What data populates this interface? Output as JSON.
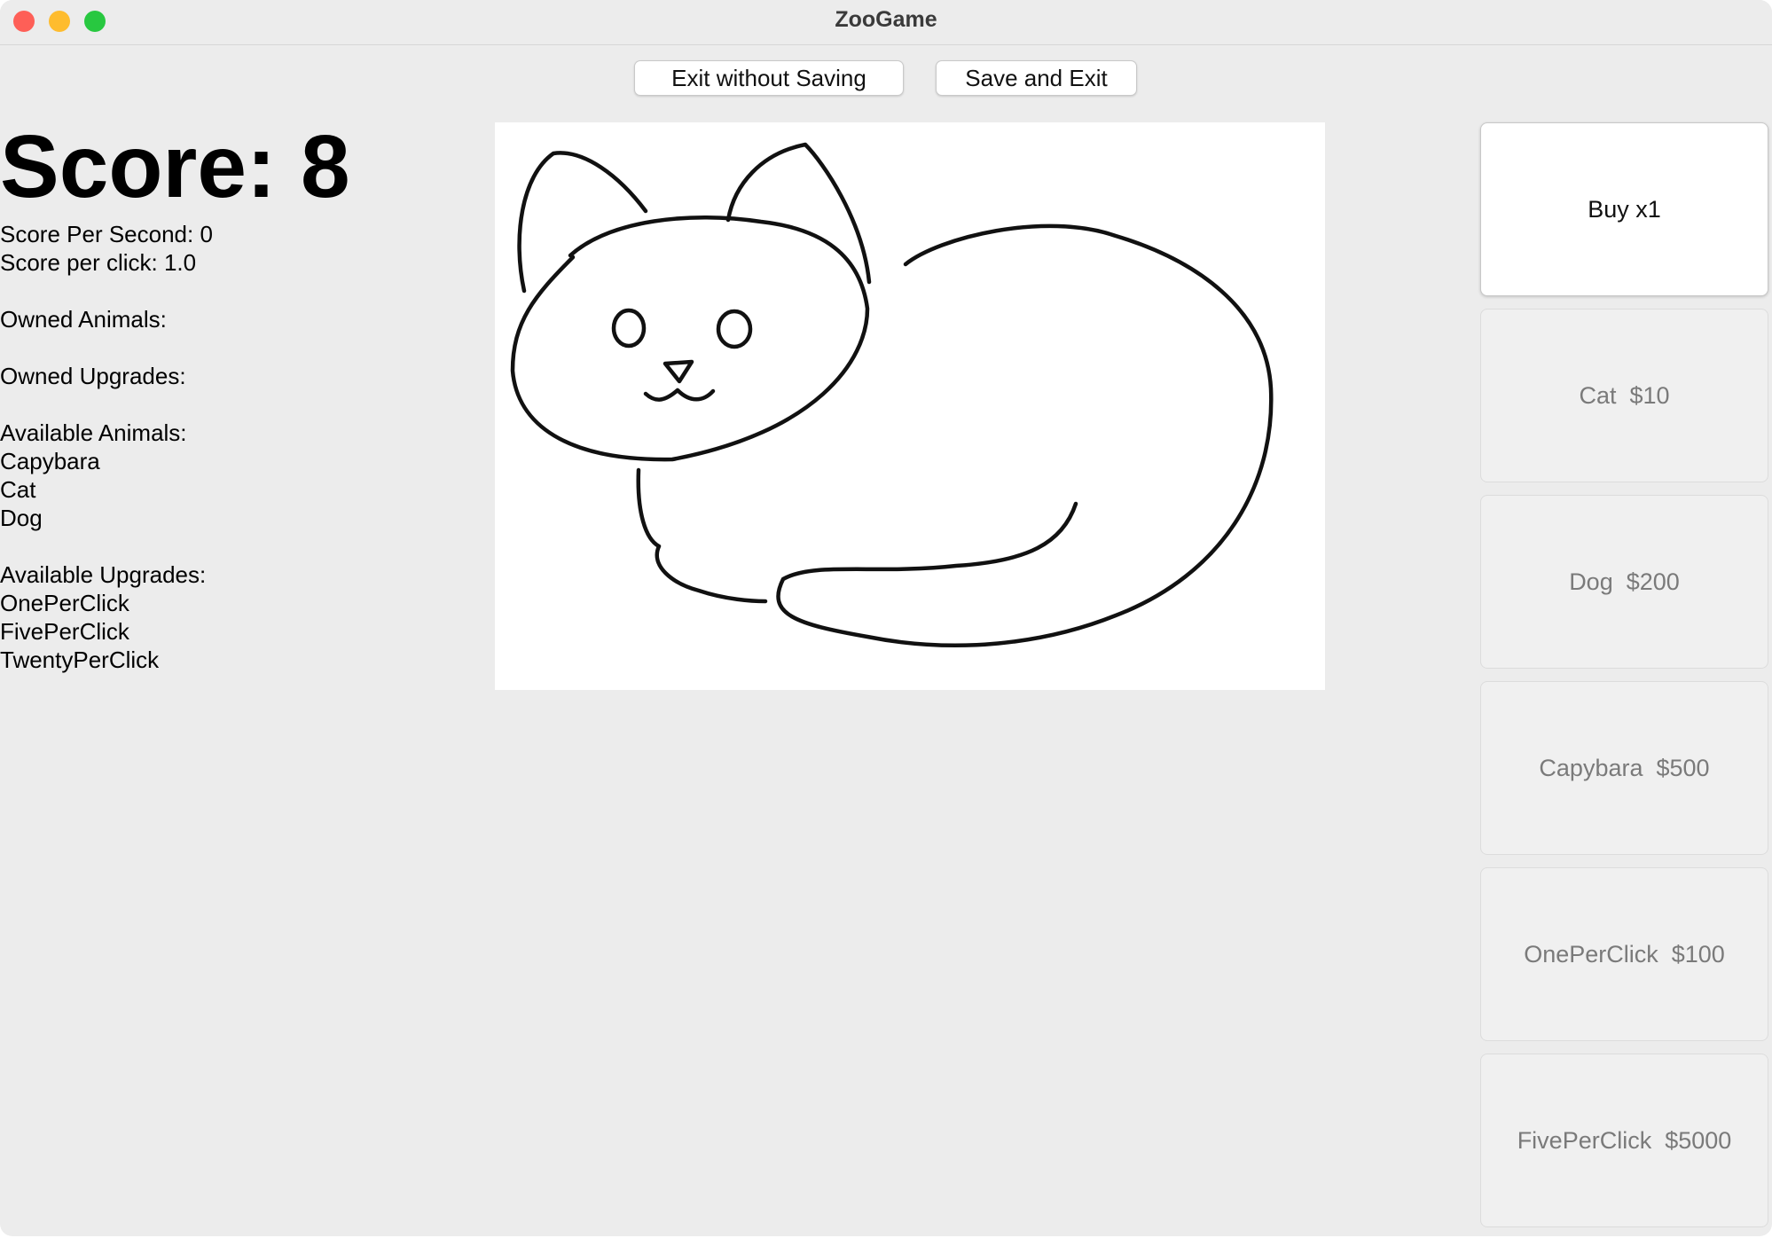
{
  "window": {
    "title": "ZooGame"
  },
  "toolbar": {
    "exit_label": "Exit without Saving",
    "save_label": "Save and Exit"
  },
  "stats": {
    "score": "Score: 8",
    "score_per_second": "Score Per Second: 0",
    "score_per_click": "Score per click: 1.0",
    "owned_animals_heading": "Owned Animals:",
    "owned_upgrades_heading": "Owned Upgrades:",
    "available_animals_heading": "Available Animals:",
    "available_animals": [
      "Capybara",
      "Cat",
      "Dog"
    ],
    "available_upgrades_heading": "Available Upgrades:",
    "available_upgrades": [
      "OnePerClick",
      "FivePerClick",
      "TwentyPerClick"
    ]
  },
  "canvas": {
    "animal_image": "cat-line-drawing"
  },
  "shop": {
    "buy_label": "Buy x1",
    "items": [
      {
        "label": "Cat  $10",
        "enabled": false
      },
      {
        "label": "Dog  $200",
        "enabled": false
      },
      {
        "label": "Capybara  $500",
        "enabled": false
      },
      {
        "label": "OnePerClick  $100",
        "enabled": false
      },
      {
        "label": "FivePerClick  $5000",
        "enabled": false
      }
    ]
  },
  "colors": {
    "window_bg": "#ececec",
    "close": "#fe5f57",
    "minimize": "#febc2e",
    "maximize": "#28c840",
    "disabled_text": "#7a7a7a"
  }
}
